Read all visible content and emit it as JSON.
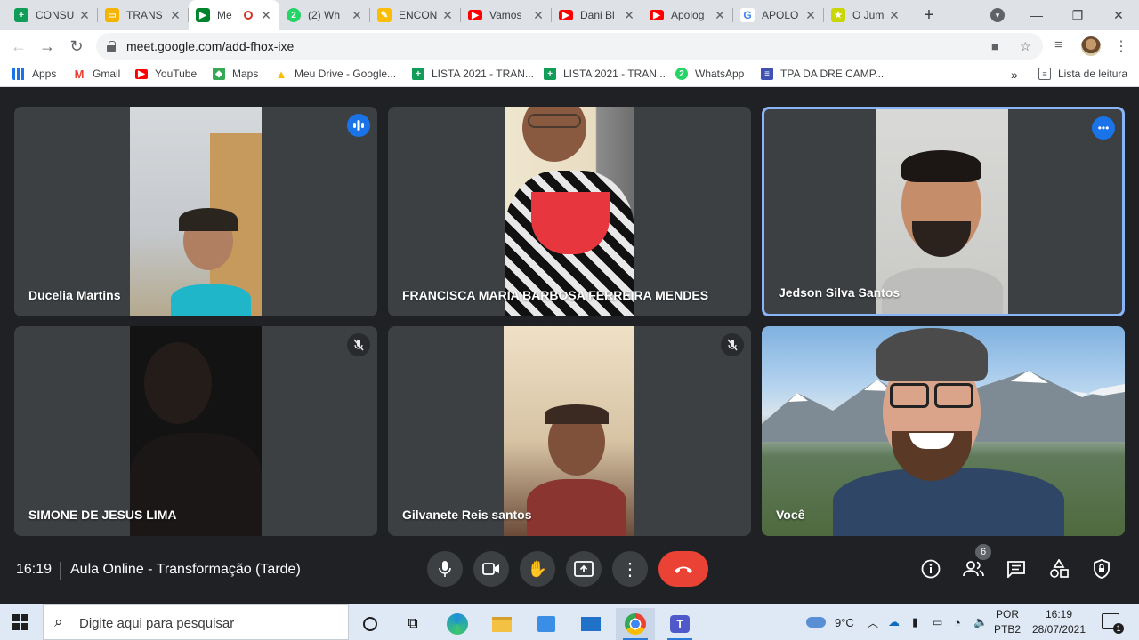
{
  "browser": {
    "tabs": [
      {
        "title": "CONSU",
        "icon": "sheets-icon",
        "color": "#0f9d58"
      },
      {
        "title": "TRANS",
        "icon": "slides-icon",
        "color": "#f4b400"
      },
      {
        "title": "Me",
        "icon": "meet-icon",
        "color": "#00832d",
        "active": true
      },
      {
        "title": "(2) Wh",
        "icon": "whatsapp-icon",
        "color": "#25d366"
      },
      {
        "title": "ENCON",
        "icon": "pencil-icon",
        "color": "#fbbc04"
      },
      {
        "title": "Vamos",
        "icon": "youtube-icon",
        "color": "#ff0000"
      },
      {
        "title": "Dani Bl",
        "icon": "youtube-icon",
        "color": "#ff0000"
      },
      {
        "title": "Apolog",
        "icon": "youtube-icon",
        "color": "#ff0000"
      },
      {
        "title": "APOLO",
        "icon": "google-icon",
        "color": "#4285f4"
      },
      {
        "title": "O Jum",
        "icon": "star-icon",
        "color": "#c9d600"
      }
    ],
    "url": "meet.google.com/add-fhox-ixe",
    "bookmarks": [
      {
        "label": "Apps",
        "icon": "apps-grid-icon"
      },
      {
        "label": "Gmail",
        "icon": "gmail-icon"
      },
      {
        "label": "YouTube",
        "icon": "youtube-icon"
      },
      {
        "label": "Maps",
        "icon": "maps-icon"
      },
      {
        "label": "Meu Drive - Google...",
        "icon": "drive-icon"
      },
      {
        "label": "LISTA 2021 - TRAN...",
        "icon": "sheets-icon"
      },
      {
        "label": "LISTA 2021 - TRAN...",
        "icon": "sheets-icon"
      },
      {
        "label": "WhatsApp",
        "icon": "whatsapp-icon"
      },
      {
        "label": "TPA DA DRE CAMP...",
        "icon": "forms-icon"
      }
    ],
    "more_bookmarks": "»",
    "reading_list": "Lista de leitura"
  },
  "meet": {
    "participants": [
      {
        "name": "Ducelia Martins",
        "status": "speaking-indicator"
      },
      {
        "name": "FRANCISCA MARIA BARBOSA FERREIRA MENDES",
        "status": ""
      },
      {
        "name": "Jedson Silva Santos",
        "status": "more-options"
      },
      {
        "name": "SIMONE DE JESUS LIMA",
        "status": "mic-off"
      },
      {
        "name": "Gilvanete Reis santos",
        "status": "mic-off"
      },
      {
        "name": "Você",
        "status": ""
      }
    ],
    "time": "16:19",
    "meeting_title": "Aula Online - Transformação (Tarde)",
    "participant_count": "6"
  },
  "taskbar": {
    "search_placeholder": "Digite aqui para pesquisar",
    "weather": "9°C",
    "lang_line1": "POR",
    "lang_line2": "PTB2",
    "clock_time": "16:19",
    "clock_date": "28/07/2021",
    "notification_count": "1"
  }
}
